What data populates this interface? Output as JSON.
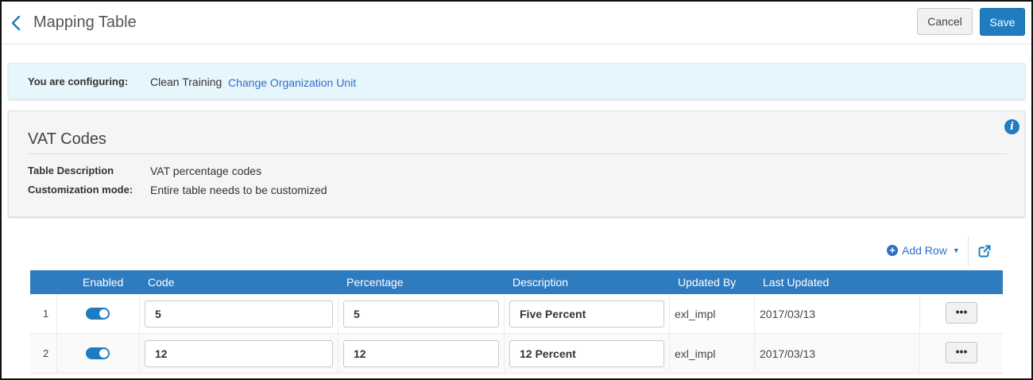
{
  "header": {
    "title": "Mapping Table",
    "cancel_label": "Cancel",
    "save_label": "Save"
  },
  "config": {
    "label": "You are configuring:",
    "value": "Clean Training",
    "link": "Change Organization Unit"
  },
  "details": {
    "title": "VAT Codes",
    "rows": [
      {
        "label": "Table Description",
        "value": "VAT percentage codes"
      },
      {
        "label": "Customization mode:",
        "value": "Entire table needs to be customized"
      }
    ]
  },
  "toolbar": {
    "add_row_label": "Add Row"
  },
  "table": {
    "columns": [
      "Enabled",
      "Code",
      "Percentage",
      "Description",
      "Updated By",
      "Last Updated"
    ],
    "rows": [
      {
        "num": "1",
        "enabled": true,
        "code": "5",
        "percentage": "5",
        "description": "Five Percent",
        "updated_by": "exl_impl",
        "last_updated": "2017/03/13",
        "actions": "•••"
      },
      {
        "num": "2",
        "enabled": true,
        "code": "12",
        "percentage": "12",
        "description": "12 Percent",
        "updated_by": "exl_impl",
        "last_updated": "2017/03/13",
        "actions": "•••"
      }
    ]
  },
  "colors": {
    "accent": "#1f7cc0",
    "table_header": "#2f7bbf",
    "link": "#2e6fc7",
    "banner_bg": "#e7f6fc"
  },
  "icons": {
    "back": "chevron-left-icon",
    "info": "info-icon",
    "add": "plus-circle-icon",
    "export": "external-link-icon"
  }
}
